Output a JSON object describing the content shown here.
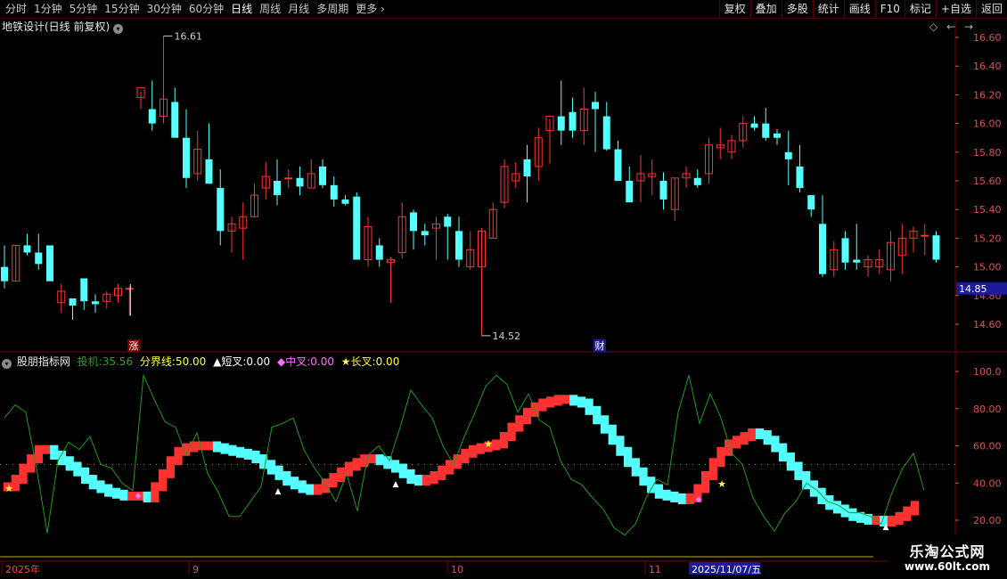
{
  "toolbar": {
    "periods": [
      "分时",
      "1分钟",
      "5分钟",
      "15分钟",
      "30分钟",
      "60分钟",
      "日线",
      "周线",
      "月线",
      "多周期"
    ],
    "active_period": "日线",
    "more": "更多",
    "right_buttons": [
      "复权",
      "叠加",
      "多股",
      "统计",
      "画线",
      "F10",
      "标记",
      "+自选",
      "返回"
    ]
  },
  "main_chart": {
    "title": "地铁设计(日线 前复权)",
    "high_label": "16.61",
    "low_label": "14.52",
    "price_axis": [
      "16.60",
      "16.40",
      "16.20",
      "16.00",
      "15.80",
      "15.60",
      "15.40",
      "15.20",
      "15.00",
      "14.80",
      "14.60"
    ],
    "current_price": "14.85",
    "marker_zhang": "涨",
    "marker_cai": "财"
  },
  "indicator": {
    "name": "股朋指标网",
    "touji_label": "投机:",
    "touji_value": "35.56",
    "fenjie_label": "分界线:",
    "fenjie_value": "50.00",
    "duancha_label": "▲短叉:",
    "duancha_value": "0.00",
    "zhongcha_label": "◆中叉:",
    "zhongcha_value": "0.00",
    "changcha_label": "★长叉:",
    "changcha_value": "0.00",
    "axis": [
      "100.0",
      "80.00",
      "60.00",
      "40.00",
      "20.00"
    ]
  },
  "time_axis": {
    "labels": [
      "2025年",
      "9",
      "10",
      "11"
    ],
    "cursor_date": "2025/11/07/五"
  },
  "watermark": {
    "line1": "乐淘公式网",
    "line2": "www.60lt.com"
  },
  "colors": {
    "up": "#ff3232",
    "down": "#54ffff",
    "grid": "#7a0000",
    "axis_text": "#e05050"
  },
  "chart_data": {
    "type": "candlestick",
    "title": "地铁设计(日线 前复权)",
    "price_range": [
      14.5,
      16.7
    ],
    "ohlc": [
      [
        15.0,
        15.15,
        14.85,
        14.9
      ],
      [
        14.9,
        15.15,
        14.9,
        15.15
      ],
      [
        15.15,
        15.23,
        15.08,
        15.1
      ],
      [
        15.1,
        15.23,
        14.98,
        15.02
      ],
      [
        15.15,
        15.15,
        14.9,
        14.9
      ],
      [
        14.75,
        14.88,
        14.68,
        14.83
      ],
      [
        14.78,
        14.78,
        14.63,
        14.73
      ],
      [
        14.92,
        14.92,
        14.7,
        14.76
      ],
      [
        14.76,
        14.81,
        14.68,
        14.74
      ],
      [
        14.76,
        14.83,
        14.71,
        14.81
      ],
      [
        14.8,
        14.88,
        14.75,
        14.85
      ],
      [
        14.85,
        14.86,
        14.66,
        14.85
      ],
      [
        16.18,
        16.22,
        16.1,
        16.25
      ],
      [
        16.1,
        16.3,
        15.95,
        16.0
      ],
      [
        16.05,
        16.61,
        16.0,
        16.17
      ],
      [
        16.15,
        16.25,
        15.95,
        15.9
      ],
      [
        15.9,
        16.1,
        15.55,
        15.62
      ],
      [
        15.65,
        15.95,
        15.6,
        15.82
      ],
      [
        15.75,
        16.0,
        15.58,
        15.58
      ],
      [
        15.55,
        15.68,
        15.15,
        15.25
      ],
      [
        15.25,
        15.35,
        15.1,
        15.3
      ],
      [
        15.27,
        15.45,
        15.05,
        15.35
      ],
      [
        15.35,
        15.58,
        15.35,
        15.5
      ],
      [
        15.55,
        15.73,
        15.47,
        15.63
      ],
      [
        15.6,
        15.75,
        15.43,
        15.5
      ],
      [
        15.62,
        15.68,
        15.55,
        15.62
      ],
      [
        15.62,
        15.7,
        15.5,
        15.56
      ],
      [
        15.55,
        15.75,
        15.55,
        15.65
      ],
      [
        15.7,
        15.75,
        15.55,
        15.57
      ],
      [
        15.57,
        15.63,
        15.42,
        15.47
      ],
      [
        15.47,
        15.5,
        15.43,
        15.44
      ],
      [
        15.49,
        15.52,
        15.1,
        15.05
      ],
      [
        15.05,
        15.35,
        15.0,
        15.28
      ],
      [
        15.15,
        15.2,
        15.0,
        15.05
      ],
      [
        15.03,
        15.07,
        14.75,
        15.05
      ],
      [
        15.1,
        15.45,
        15.06,
        15.35
      ],
      [
        15.38,
        15.4,
        15.12,
        15.25
      ],
      [
        15.25,
        15.3,
        15.15,
        15.22
      ],
      [
        15.27,
        15.35,
        15.05,
        15.3
      ],
      [
        15.35,
        15.37,
        15.05,
        15.28
      ],
      [
        15.25,
        15.35,
        15.0,
        15.05
      ],
      [
        15.0,
        15.25,
        14.98,
        15.12
      ],
      [
        15.0,
        15.27,
        14.52,
        15.25
      ],
      [
        15.2,
        15.45,
        15.2,
        15.4
      ],
      [
        15.45,
        15.75,
        15.41,
        15.7
      ],
      [
        15.6,
        15.73,
        15.55,
        15.65
      ],
      [
        15.75,
        15.85,
        15.45,
        15.63
      ],
      [
        15.7,
        15.97,
        15.6,
        15.9
      ],
      [
        15.95,
        16.03,
        15.72,
        16.05
      ],
      [
        16.05,
        16.3,
        15.85,
        15.95
      ],
      [
        16.08,
        16.18,
        15.9,
        15.95
      ],
      [
        15.95,
        16.25,
        15.85,
        16.1
      ],
      [
        16.15,
        16.22,
        15.8,
        16.1
      ],
      [
        16.05,
        16.15,
        15.81,
        15.82
      ],
      [
        15.82,
        15.88,
        15.6,
        15.6
      ],
      [
        15.6,
        15.7,
        15.45,
        15.45
      ],
      [
        15.6,
        15.78,
        15.45,
        15.65
      ],
      [
        15.63,
        15.75,
        15.5,
        15.65
      ],
      [
        15.6,
        15.66,
        15.4,
        15.47
      ],
      [
        15.4,
        15.62,
        15.32,
        15.62
      ],
      [
        15.62,
        15.7,
        15.55,
        15.65
      ],
      [
        15.62,
        15.68,
        15.55,
        15.57
      ],
      [
        15.65,
        15.9,
        15.58,
        15.85
      ],
      [
        15.83,
        15.97,
        15.75,
        15.85
      ],
      [
        15.8,
        15.92,
        15.75,
        15.88
      ],
      [
        15.88,
        16.05,
        15.83,
        16.0
      ],
      [
        16.0,
        16.05,
        15.95,
        15.97
      ],
      [
        16.0,
        16.11,
        15.88,
        15.9
      ],
      [
        15.93,
        15.96,
        15.85,
        15.9
      ],
      [
        15.8,
        15.95,
        15.57,
        15.75
      ],
      [
        15.7,
        15.85,
        15.52,
        15.55
      ],
      [
        15.5,
        15.4,
        15.35,
        15.4
      ],
      [
        15.3,
        15.5,
        14.93,
        14.95
      ],
      [
        14.98,
        15.18,
        14.93,
        15.12
      ],
      [
        15.2,
        15.25,
        14.98,
        15.03
      ],
      [
        15.05,
        15.3,
        14.98,
        15.03
      ],
      [
        15.0,
        15.08,
        14.93,
        15.05
      ],
      [
        15.0,
        15.12,
        14.95,
        15.05
      ],
      [
        14.98,
        15.25,
        14.9,
        15.17
      ],
      [
        15.08,
        15.3,
        14.95,
        15.2
      ],
      [
        15.2,
        15.28,
        15.1,
        15.25
      ],
      [
        15.22,
        15.3,
        15.08,
        15.22
      ],
      [
        15.22,
        15.25,
        15.03,
        15.05
      ]
    ],
    "indicator_ribbon": {
      "name": "股朋指标网",
      "range": [
        10,
        102
      ],
      "values": [
        38,
        42,
        48,
        53,
        58,
        58,
        55,
        52,
        49,
        46,
        42,
        39,
        37,
        35,
        34,
        33,
        33,
        33,
        32,
        38,
        45,
        52,
        57,
        59,
        60,
        60,
        60,
        59,
        58,
        57,
        56,
        55,
        53,
        50,
        47,
        44,
        41,
        39,
        37,
        36,
        37,
        40,
        43,
        46,
        49,
        51,
        53,
        53,
        52,
        50,
        48,
        45,
        42,
        41,
        42,
        44,
        47,
        50,
        53,
        56,
        58,
        59,
        60,
        61,
        65,
        70,
        74,
        78,
        81,
        83,
        84,
        85,
        85,
        84,
        83,
        79,
        74,
        69,
        63,
        57,
        51,
        46,
        41,
        37,
        34,
        33,
        32,
        31,
        32,
        37,
        44,
        51,
        57,
        61,
        63,
        65,
        67,
        66,
        63,
        59,
        54,
        49,
        44,
        39,
        35,
        31,
        28,
        26,
        24,
        22,
        21,
        20,
        20,
        19,
        20,
        22,
        25,
        28
      ]
    },
    "indicator_line": {
      "name": "投机",
      "values": [
        75,
        82,
        78,
        48,
        13,
        52,
        62,
        58,
        65,
        50,
        48,
        40,
        36,
        98,
        85,
        73,
        70,
        55,
        67,
        45,
        35,
        22,
        22,
        30,
        38,
        70,
        72,
        75,
        58,
        48,
        40,
        30,
        45,
        25,
        55,
        60,
        52,
        70,
        90,
        82,
        75,
        60,
        50,
        65,
        78,
        92,
        98,
        93,
        78,
        88,
        74,
        70,
        52,
        42,
        39,
        32,
        26,
        16,
        12,
        18,
        32,
        42,
        39,
        78,
        98,
        72,
        88,
        75,
        56,
        50,
        32,
        22,
        14,
        24,
        30,
        40,
        36,
        30,
        28,
        24,
        24,
        22,
        18,
        35,
        48,
        56,
        36
      ]
    }
  }
}
